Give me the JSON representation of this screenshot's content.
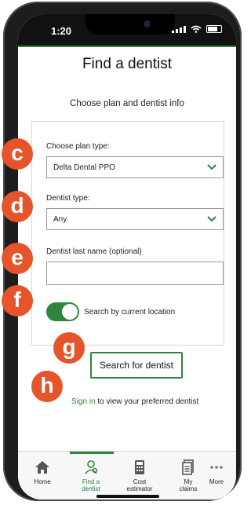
{
  "status": {
    "time": "1:20"
  },
  "header": {
    "title": "Find a dentist"
  },
  "main": {
    "subtitle": "Choose plan and dentist info",
    "plan": {
      "label": "Choose plan type:",
      "value": "Delta Dental PPO"
    },
    "dentist_type": {
      "label": "Dentist type:",
      "value": "Any"
    },
    "last_name": {
      "label": "Dentist last name (optional)",
      "value": ""
    },
    "location_toggle": {
      "label": "Search by current location",
      "on": true
    },
    "search_button": "Search for dentist",
    "signin": {
      "link": "Sign in",
      "text": " to view your preferred dentist"
    }
  },
  "tabs": [
    {
      "label1": "Home",
      "label2": "",
      "icon": "home-icon"
    },
    {
      "label1": "Find a",
      "label2": "dentist",
      "icon": "find-dentist-icon"
    },
    {
      "label1": "Cost",
      "label2": "estimator",
      "icon": "calculator-icon"
    },
    {
      "label1": "My",
      "label2": "claims",
      "icon": "claims-icon"
    },
    {
      "label1": "More",
      "label2": "",
      "icon": "more-dots-icon"
    }
  ],
  "annotations": {
    "c": "c",
    "d": "d",
    "e": "e",
    "f": "f",
    "g": "g",
    "h": "h"
  },
  "colors": {
    "accent": "#2e8540",
    "badge": "#e5542b"
  }
}
